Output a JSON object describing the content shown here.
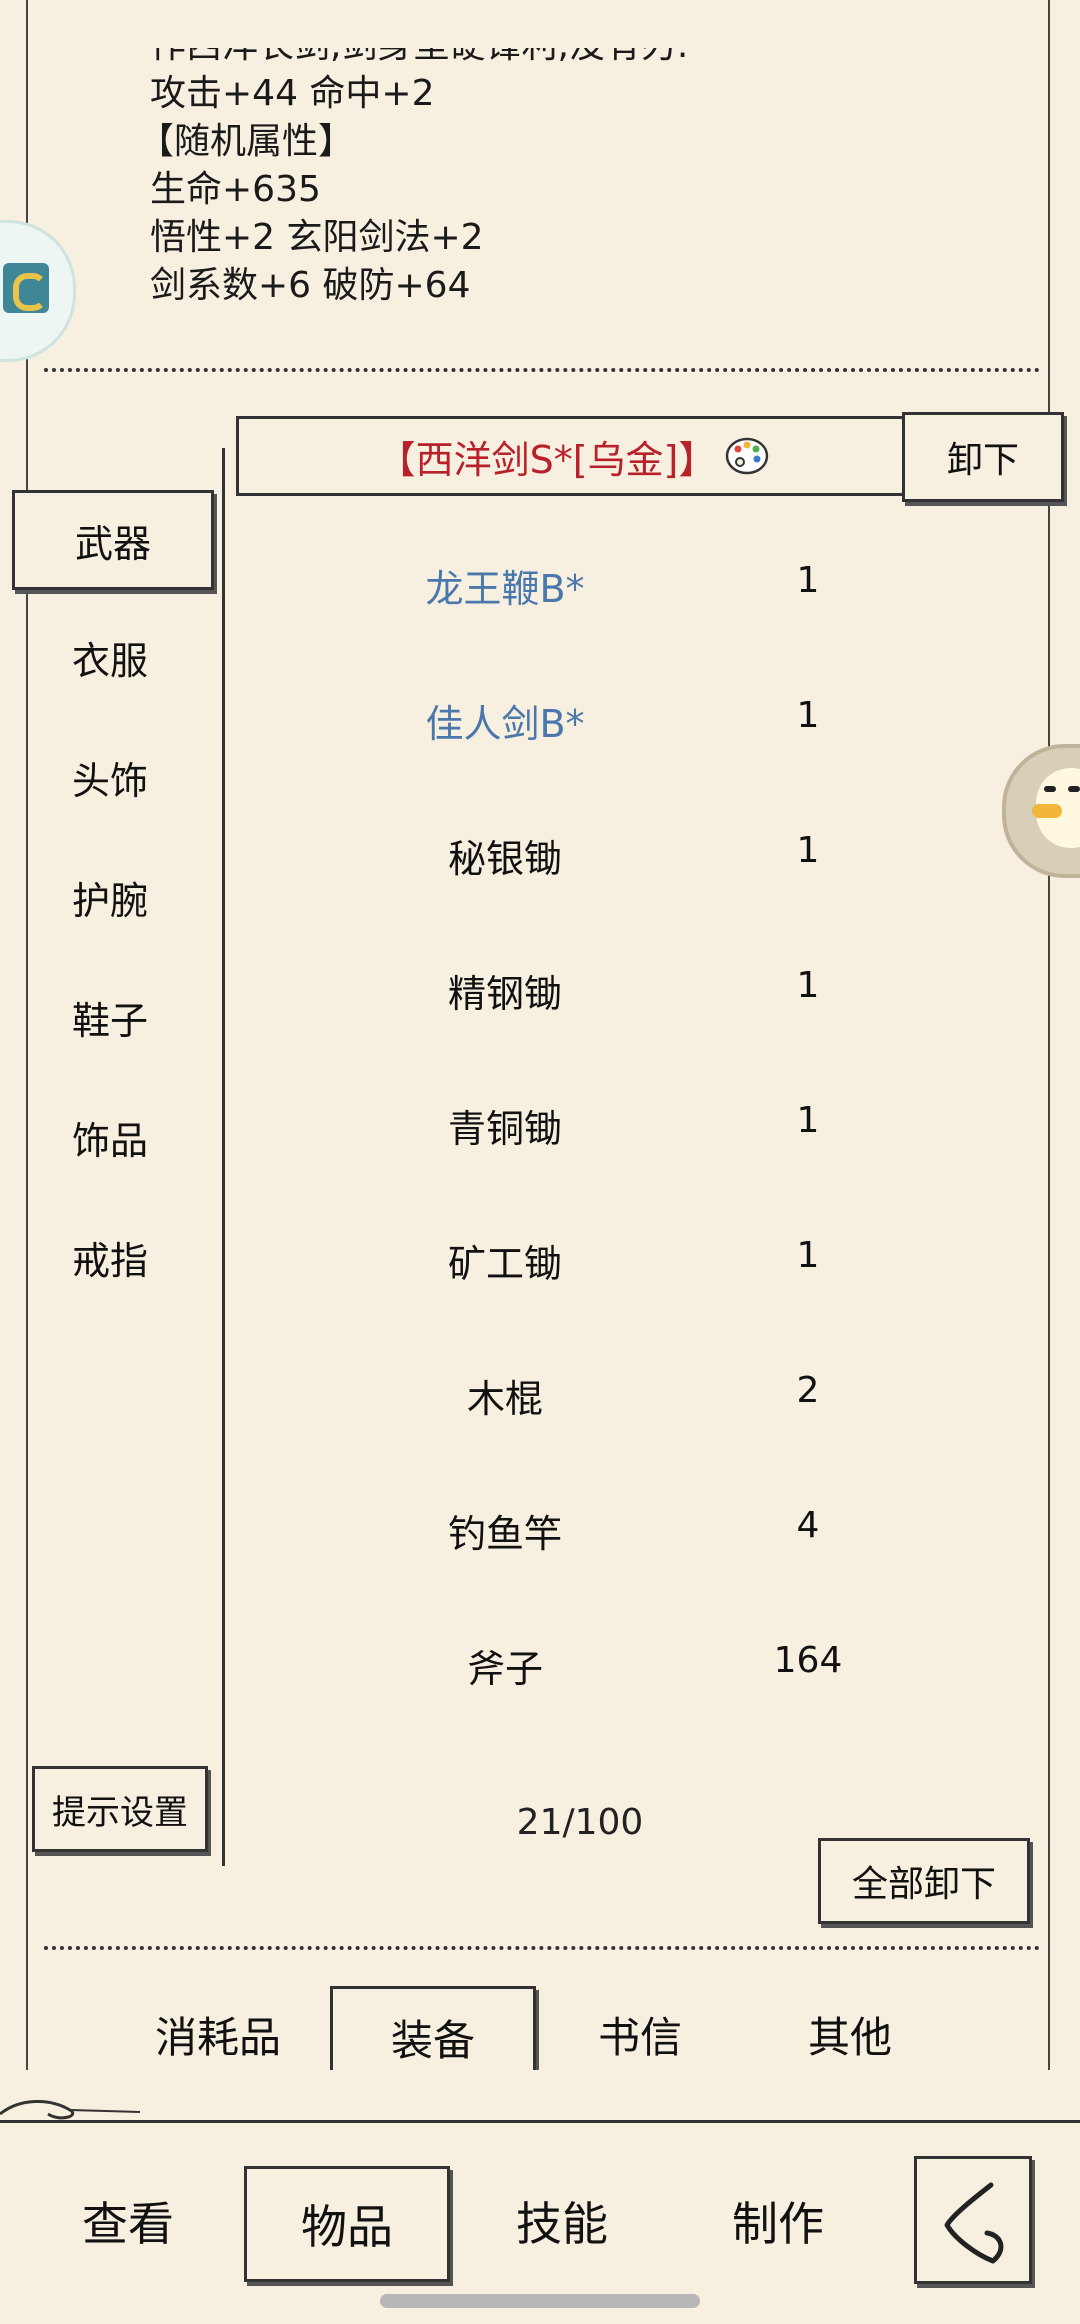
{
  "description": {
    "cut_line": "作西洋长剑,剑身坚硬锋利,没有刃.",
    "lines": [
      "攻击+44 命中+2",
      "【随机属性】",
      "生命+635",
      "悟性+2 玄阳剑法+2",
      "剑系数+6 破防+64"
    ]
  },
  "equipped": {
    "name": "【西洋剑S*[乌金]】",
    "name_color": "#b8202a",
    "palette_icon": "palette-icon",
    "unequip_label": "卸下"
  },
  "sidebar": {
    "items": [
      {
        "label": "武器",
        "active": true
      },
      {
        "label": "衣服"
      },
      {
        "label": "头饰"
      },
      {
        "label": "护腕"
      },
      {
        "label": "鞋子"
      },
      {
        "label": "饰品"
      },
      {
        "label": "戒指"
      }
    ],
    "hint_label": "提示设置"
  },
  "items": [
    {
      "name": "龙王鞭B*",
      "count": "1",
      "color": "#4a78ad"
    },
    {
      "name": "佳人剑B*",
      "count": "1",
      "color": "#4a78ad"
    },
    {
      "name": "秘银锄",
      "count": "1"
    },
    {
      "name": "精钢锄",
      "count": "1"
    },
    {
      "name": "青铜锄",
      "count": "1"
    },
    {
      "name": "矿工锄",
      "count": "1"
    },
    {
      "name": "木棍",
      "count": "2"
    },
    {
      "name": "钓鱼竿",
      "count": "4"
    },
    {
      "name": "斧子",
      "count": "164"
    }
  ],
  "capacity": "21/100",
  "unequip_all_label": "全部卸下",
  "categories": [
    {
      "label": "消耗品"
    },
    {
      "label": "装备",
      "active": true
    },
    {
      "label": "书信"
    },
    {
      "label": "其他"
    }
  ],
  "bottom_nav": [
    {
      "label": "查看"
    },
    {
      "label": "物品",
      "active": true
    },
    {
      "label": "技能"
    },
    {
      "label": "制作"
    }
  ],
  "back_icon": "back-chevron-icon",
  "floating_left_icon": "app-badge-icon",
  "floating_right_icon": "duck-mascot-icon"
}
